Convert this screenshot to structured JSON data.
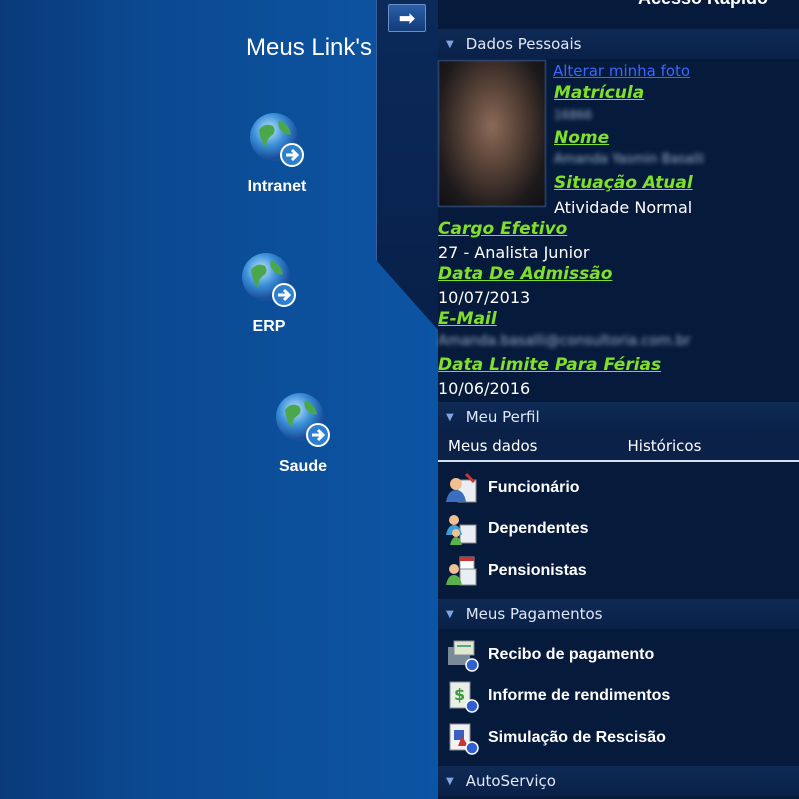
{
  "links": {
    "title": "Meus Link's",
    "items": [
      {
        "label": "Intranet",
        "icon": "globe-link-icon"
      },
      {
        "label": "ERP",
        "icon": "globe-link-icon"
      },
      {
        "label": "Saude",
        "icon": "globe-link-icon"
      }
    ]
  },
  "panel": {
    "title": "Acesso Rápido",
    "personal": {
      "header": "Dados Pessoais",
      "change_photo": "Alterar minha foto",
      "matricula_label": "Matrícula",
      "matricula_value": "16866",
      "nome_label": "Nome",
      "nome_value": "Amanda Yasmin Basalli",
      "situacao_label": "Situação Atual",
      "situacao_value": "Atividade Normal",
      "cargo_label": "Cargo Efetivo",
      "cargo_value": "27 - Analista Junior",
      "admissao_label": "Data De Admissão",
      "admissao_value": "10/07/2013",
      "email_label": "E-Mail",
      "email_value": "Amanda.basalli@consultoria.com.br",
      "ferias_label": "Data Limite Para Férias",
      "ferias_value": "10/06/2016"
    },
    "profile": {
      "header": "Meu Perfil",
      "tabs": [
        "Meus dados",
        "Históricos"
      ],
      "items": [
        "Funcionário",
        "Dependentes",
        "Pensionistas"
      ]
    },
    "payments": {
      "header": "Meus Pagamentos",
      "items": [
        "Recibo de pagamento",
        "Informe de rendimentos",
        "Simulação de Rescisão"
      ]
    },
    "self_service": {
      "header": "AutoServiço"
    }
  },
  "colors": {
    "label_green": "#7fe02a",
    "link_blue": "#3b66ff",
    "panel_bg": "#061a3c"
  }
}
